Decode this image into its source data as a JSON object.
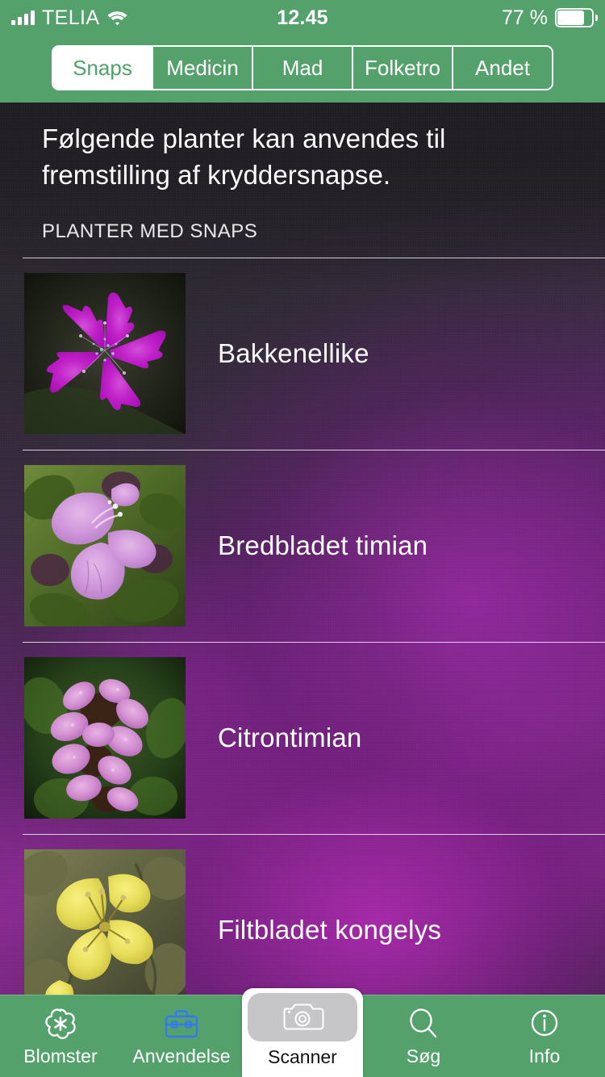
{
  "status_bar": {
    "carrier": "TELIA",
    "time": "12.45",
    "battery_percent": "77 %",
    "signal_icon": "signal-bars-icon",
    "wifi_icon": "wifi-icon",
    "battery_icon": "battery-icon"
  },
  "segmented_control": {
    "selected": "Snaps",
    "segments": [
      {
        "label": "Snaps",
        "active": true
      },
      {
        "label": "Medicin",
        "active": false
      },
      {
        "label": "Mad",
        "active": false
      },
      {
        "label": "Folketro",
        "active": false
      },
      {
        "label": "Andet",
        "active": false
      }
    ]
  },
  "main": {
    "intro_text": "Følgende planter kan anvendes til fremstilling af kryddersnapse.",
    "section_header": "PLANTER MED SNAPS",
    "plants": [
      {
        "name": "Bakkenellike",
        "thumb": "magenta-dianthus-flower-photo"
      },
      {
        "name": "Bredbladet timian",
        "thumb": "pink-thyme-flower-photo"
      },
      {
        "name": "Citrontimian",
        "thumb": "lilac-lemon-thyme-flower-photo"
      },
      {
        "name": "Filtbladet kongelys",
        "thumb": "yellow-mullein-flower-photo"
      }
    ]
  },
  "tab_bar": {
    "active": "Anvendelse",
    "tabs": [
      {
        "label": "Blomster",
        "icon": "flower-icon"
      },
      {
        "label": "Anvendelse",
        "icon": "briefcase-icon"
      },
      {
        "label": "Scanner",
        "icon": "camera-icon"
      },
      {
        "label": "Søg",
        "icon": "search-icon"
      },
      {
        "label": "Info",
        "icon": "info-icon"
      }
    ]
  },
  "colors": {
    "brand_green": "#54a16c",
    "active_tint_blue": "#3478f6",
    "accent_purple": "#8e2a95",
    "text_light": "#ffffff"
  }
}
